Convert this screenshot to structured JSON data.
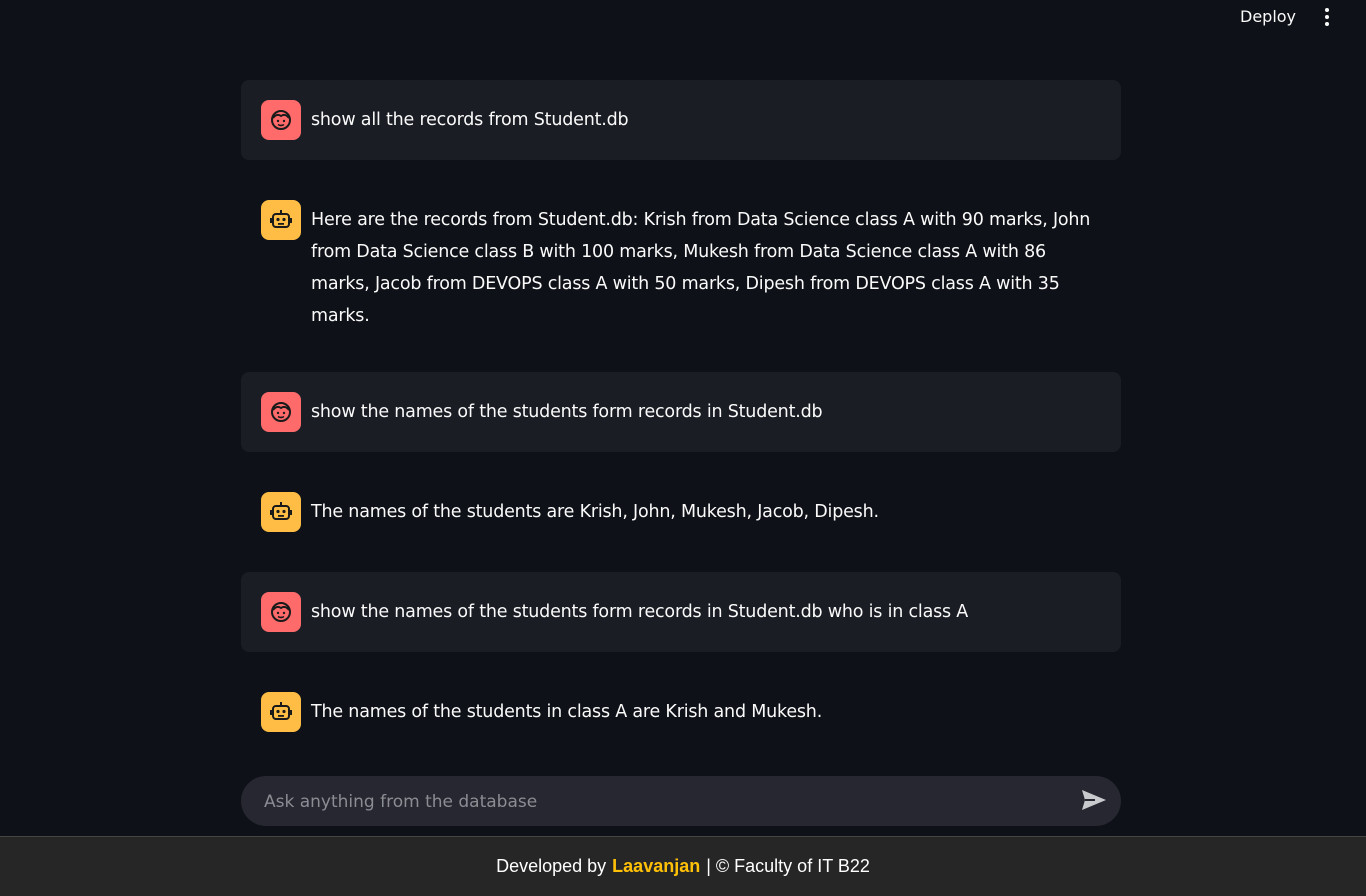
{
  "header": {
    "deploy_label": "Deploy",
    "menu_icon": "vertical-dots-icon"
  },
  "messages": [
    {
      "role": "user",
      "avatar_icon": "user-face-icon",
      "text": "show all the records from Student.db"
    },
    {
      "role": "assistant",
      "avatar_icon": "robot-icon",
      "text": "Here are the records from Student.db: Krish from Data Science class A with 90 marks, John from Data Science class B with 100 marks, Mukesh from Data Science class A with 86 marks, Jacob from DEVOPS class A with 50 marks, Dipesh from DEVOPS class A with 35 marks."
    },
    {
      "role": "user",
      "avatar_icon": "user-face-icon",
      "text": "show the names of the students form records in Student.db"
    },
    {
      "role": "assistant",
      "avatar_icon": "robot-icon",
      "text": "The names of the students are Krish, John, Mukesh, Jacob, Dipesh."
    },
    {
      "role": "user",
      "avatar_icon": "user-face-icon",
      "text": "show the names of the students form records in Student.db who is in class A"
    },
    {
      "role": "assistant",
      "avatar_icon": "robot-icon",
      "text": "The names of the students in class A are Krish and Mukesh."
    }
  ],
  "input": {
    "placeholder": "Ask anything from the database",
    "value": "",
    "send_icon": "send-arrow-icon"
  },
  "footer": {
    "prefix": "Developed by",
    "name": "Laavanjan",
    "suffix": "| © Faculty of IT B22"
  },
  "colors": {
    "background": "#0e1117",
    "user_message_bg": "#1a1d24",
    "user_avatar": "#ff6b6b",
    "assistant_avatar": "#ffbd45",
    "input_bg": "#262730",
    "footer_bg": "#262626",
    "footer_name": "#ffc107"
  }
}
